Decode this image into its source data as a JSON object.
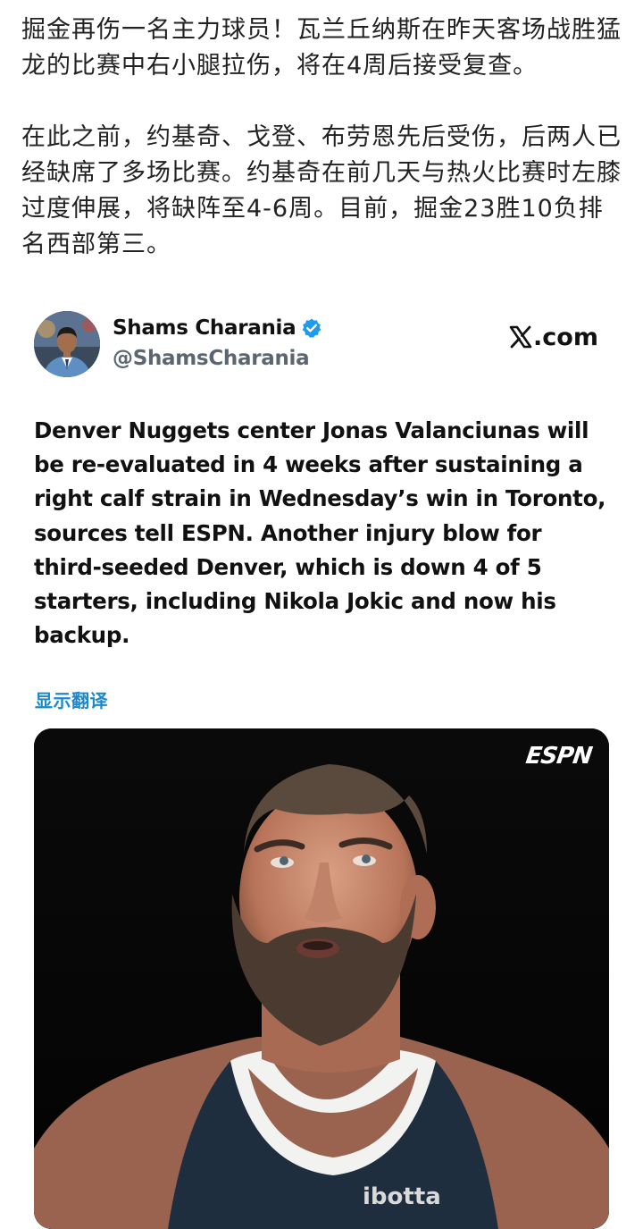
{
  "article": {
    "paragraph_1": "掘金再伤一名主力球员！瓦兰丘纳斯在昨天客场战胜猛龙的比赛中右小腿拉伤，将在4周后接受复查。",
    "paragraph_2": "在此之前，约基奇、戈登、布劳恩先后受伤，后两人已经缺席了多场比赛。约基奇在前几天与热火比赛时左膝过度伸展，将缺阵至4-6周。目前，掘金23胜10负排名西部第三。"
  },
  "tweet": {
    "author_name": "Shams Charania",
    "author_handle": "@ShamsCharania",
    "source_label": ".com",
    "verified_color": "#1d9bf0",
    "text": "Denver Nuggets center Jonas Valanciunas will be re-evaluated in 4 weeks after sustaining a right calf strain in Wednesday’s win in Toronto, sources tell ESPN. Another injury blow for third-seeded Denver, which is down 4 of 5 starters, including Nikola Jokic and now his backup.",
    "translate_label": "显示翻译",
    "media": {
      "watermark": "ESPN",
      "jersey_text": "ibotta"
    }
  },
  "colors": {
    "link": "#1e88c8",
    "handle": "#5b6670",
    "media_bg": "#060606"
  }
}
